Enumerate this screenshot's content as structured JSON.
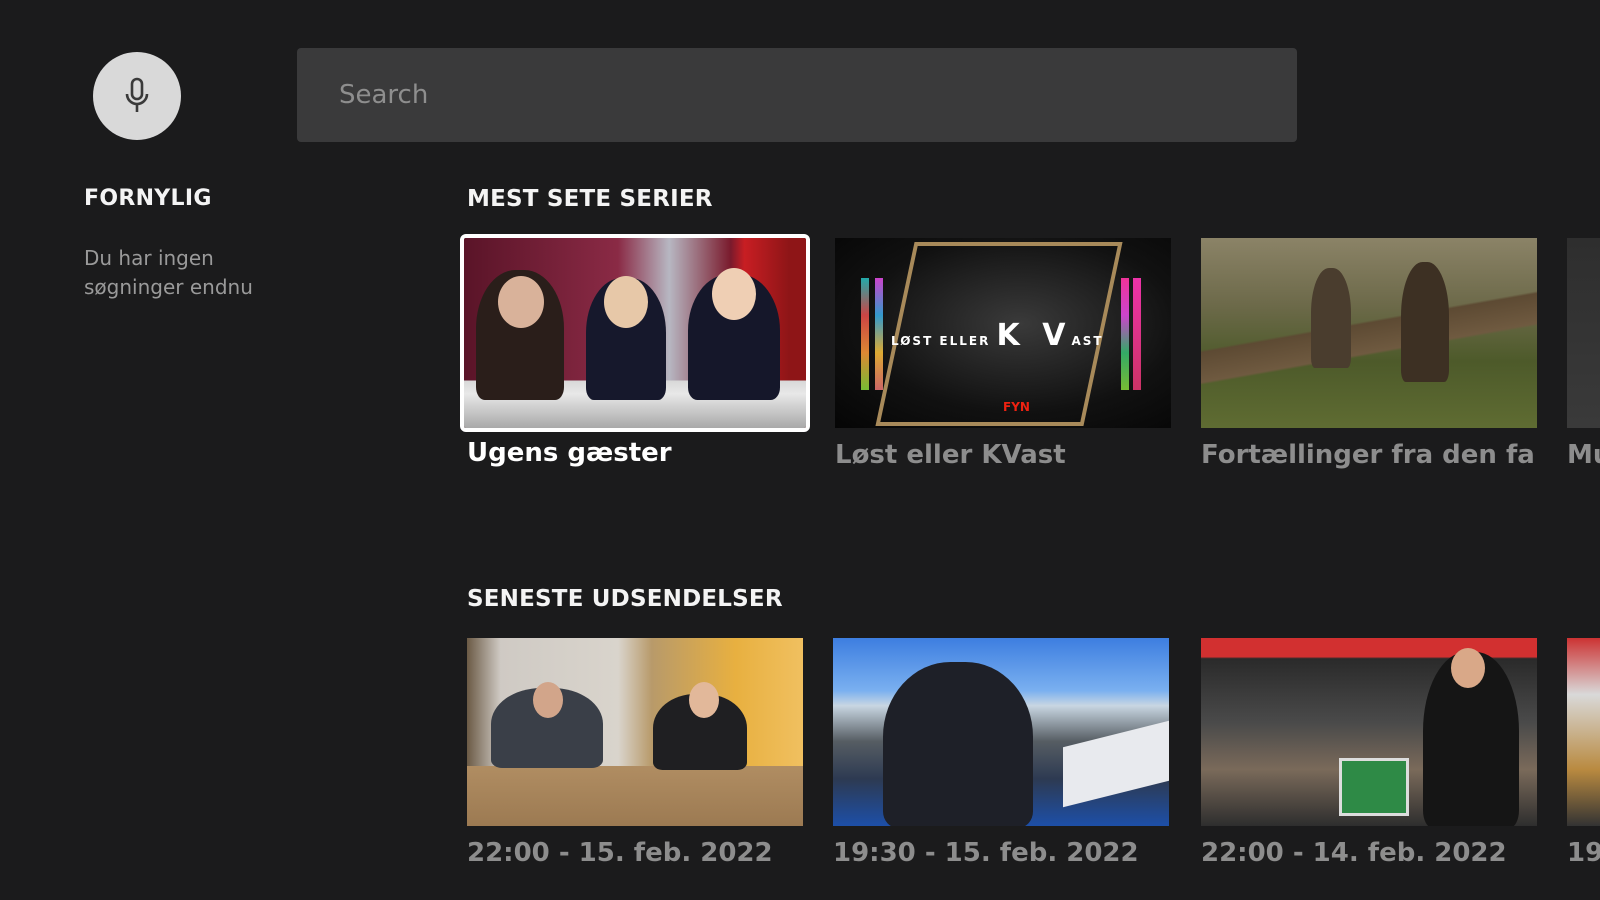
{
  "search": {
    "placeholder": "Search",
    "mic_icon": "microphone-icon"
  },
  "recent": {
    "title": "FORNYLIG",
    "empty_text": "Du har ingen søgninger endnu"
  },
  "sections": [
    {
      "title": "MEST SETE SERIER",
      "items": [
        {
          "label": "Ugens gæster",
          "focused": true
        },
        {
          "label": "Løst eller KVast",
          "focused": false
        },
        {
          "label": "Fortællinger fra den fa..",
          "focused": false
        },
        {
          "label": "Mu",
          "focused": false
        }
      ]
    },
    {
      "title": "SENESTE UDSENDELSER",
      "items": [
        {
          "label": "22:00 - 15. feb. 2022"
        },
        {
          "label": "19:30 - 15. feb. 2022"
        },
        {
          "label": "22:00 - 14. feb. 2022"
        },
        {
          "label": "19"
        }
      ]
    }
  ],
  "kvast_logo": {
    "small": "LØST ELLER",
    "big": "K V",
    "tail": "AST",
    "badge": "FYN"
  },
  "colors": {
    "background": "#1b1b1c",
    "search_bg": "#3a3a3b",
    "focus_border": "#ffffff",
    "muted_text": "#8d8d8d"
  }
}
